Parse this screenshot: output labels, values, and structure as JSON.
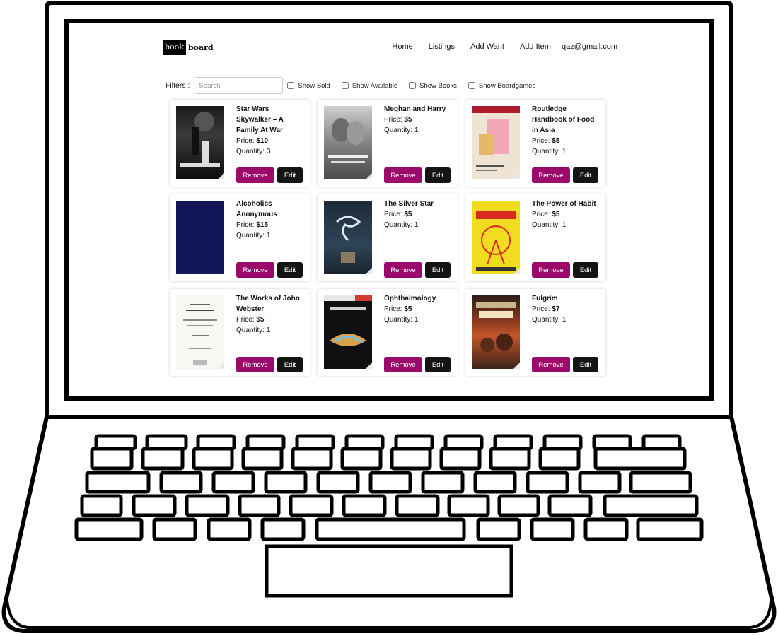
{
  "nav": {
    "logo_box": "book",
    "logo_text": "board",
    "links": [
      "Home",
      "Listings",
      "Add Want",
      "Add Item"
    ],
    "user_email": "qaz@gmail.com"
  },
  "filters": {
    "label": "Filters :",
    "search_placeholder": "Search",
    "options": [
      "Show Sold",
      "Show Available",
      "Show Books",
      "Show Boardgames"
    ]
  },
  "listing": {
    "price_label": "Price:",
    "quantity_label": "Quantity:",
    "remove_label": "Remove",
    "edit_label": "Edit"
  },
  "cards": [
    {
      "title": "Star Wars Skywalker – A Family At War",
      "price": "$10",
      "quantity": "3"
    },
    {
      "title": "Meghan and Harry",
      "price": "$5",
      "quantity": "1"
    },
    {
      "title": "Routledge Handbook of Food in Asia",
      "price": "$5",
      "quantity": "1"
    },
    {
      "title": "Alcoholics Anonymous",
      "price": "$15",
      "quantity": "1"
    },
    {
      "title": "The Silver Star",
      "price": "$5",
      "quantity": "1"
    },
    {
      "title": "The Power of Habit",
      "price": "$5",
      "quantity": "1"
    },
    {
      "title": "The Works of John Webster",
      "price": "$5",
      "quantity": "1"
    },
    {
      "title": "Ophthalmology",
      "price": "$5",
      "quantity": "1"
    },
    {
      "title": "Fulgrim",
      "price": "$7",
      "quantity": "1"
    }
  ],
  "colors": {
    "remove_button": "#9b0a6b",
    "edit_button": "#141414",
    "logo_background": "#000000"
  }
}
